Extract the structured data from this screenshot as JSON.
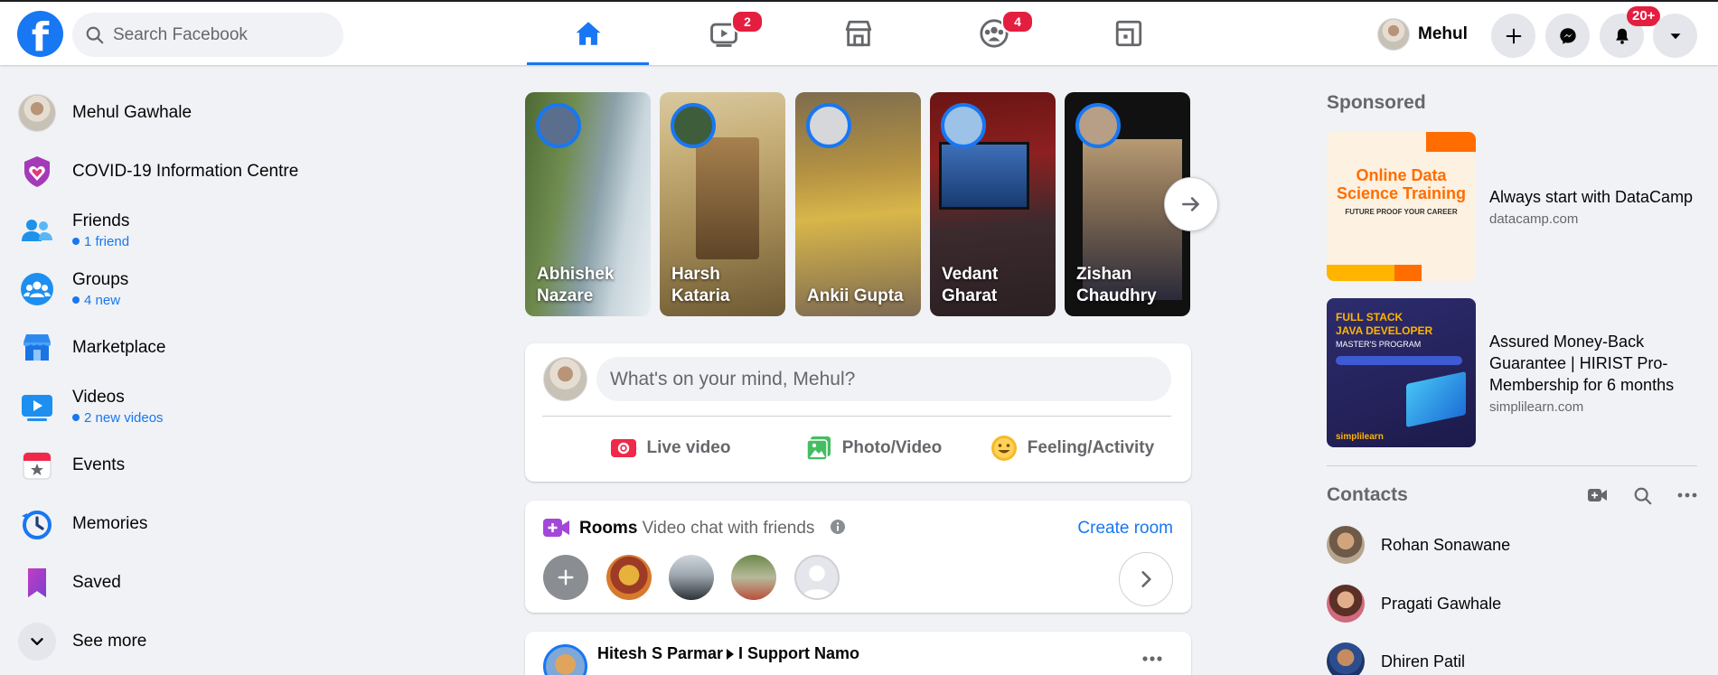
{
  "topbar": {
    "search_placeholder": "Search Facebook",
    "tabs": [
      {
        "name": "home",
        "badge": ""
      },
      {
        "name": "watch",
        "badge": "2"
      },
      {
        "name": "marketplace",
        "badge": ""
      },
      {
        "name": "groups",
        "badge": "4"
      },
      {
        "name": "gaming",
        "badge": ""
      }
    ],
    "profile_name": "Mehul",
    "notifications_badge": "20+"
  },
  "sidebar": {
    "items": [
      {
        "label": "Mehul Gawhale",
        "sub": ""
      },
      {
        "label": "COVID-19 Information Centre",
        "sub": ""
      },
      {
        "label": "Friends",
        "sub": "1 friend"
      },
      {
        "label": "Groups",
        "sub": "4 new"
      },
      {
        "label": "Marketplace",
        "sub": ""
      },
      {
        "label": "Videos",
        "sub": "2 new videos"
      },
      {
        "label": "Events",
        "sub": ""
      },
      {
        "label": "Memories",
        "sub": ""
      },
      {
        "label": "Saved",
        "sub": ""
      },
      {
        "label": "See more",
        "sub": ""
      }
    ]
  },
  "stories": [
    {
      "name": "Abhishek Nazare",
      "line1": "Abhishek",
      "line2": "Nazare"
    },
    {
      "name": "Harsh Kataria",
      "line1": "Harsh",
      "line2": "Kataria"
    },
    {
      "name": "Ankii Gupta",
      "line1": "",
      "line2": "Ankii Gupta"
    },
    {
      "name": "Vedant Gharat",
      "line1": "Vedant",
      "line2": "Gharat"
    },
    {
      "name": "Zishan Chaudhry",
      "line1": "Zishan",
      "line2": "Chaudhry"
    }
  ],
  "composer": {
    "placeholder": "What's on your mind, Mehul?",
    "live_video": "Live video",
    "photo_video": "Photo/Video",
    "feeling": "Feeling/Activity"
  },
  "rooms": {
    "title": "Rooms",
    "subtitle": "· Video chat with friends",
    "create": "Create room"
  },
  "post": {
    "author": "Hitesh S Parmar",
    "group": "I Support Namo"
  },
  "sponsored": {
    "heading": "Sponsored",
    "ads": [
      {
        "title": "Always start with DataCamp",
        "domain": "datacamp.com",
        "image_title_1": "Online Data",
        "image_title_2": "Science Training",
        "image_sub": "FUTURE PROOF YOUR CAREER"
      },
      {
        "title": "Assured Money-Back Guarantee | HIRIST Pro-Membership for 6 months",
        "domain": "simplilearn.com",
        "image_title_1": "FULL STACK",
        "image_title_2": "JAVA DEVELOPER",
        "image_sub": "MASTER'S PROGRAM",
        "image_brand": "simplilearn"
      }
    ]
  },
  "contacts": {
    "heading": "Contacts",
    "people": [
      "Rohan Sonawane",
      "Pragati Gawhale",
      "Dhiren Patil"
    ]
  },
  "colors": {
    "brand": "#1877f2",
    "badge": "#e41e3f",
    "background": "#f0f2f5"
  }
}
